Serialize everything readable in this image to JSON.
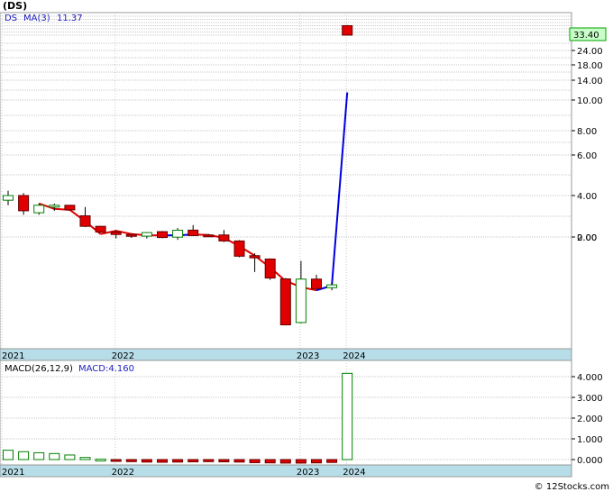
{
  "ticker": "(DS)",
  "legend": {
    "symbol": "DS",
    "ma_label": "MA(3)",
    "ma_value": "11.37"
  },
  "macd_legend": {
    "label": "MACD(26,12,9)",
    "value_label": "MACD:4.160"
  },
  "last_price_label": "33.40",
  "watermark": "© 12Stocks.com",
  "colors": {
    "up_candle": "#008000",
    "down_candle": "#e00000",
    "ma_down": "#e00000",
    "ma_up": "#0000e0",
    "axis_strip": "#b7dde8",
    "price_box": "#c8ffc8"
  },
  "chart_data": [
    {
      "type": "candlestick",
      "y_scale": "log",
      "y_tick_labels": [
        "33.40",
        "24.00",
        "18.00",
        "14.00",
        "10.00",
        "8.00",
        "6.00",
        "4.00",
        "2.00",
        "0.00"
      ],
      "y_tick_values": [
        33.4,
        24,
        18,
        14,
        10,
        8,
        6,
        4,
        2,
        1
      ],
      "x_labels": [
        "2021",
        "2022",
        "2023",
        "2024"
      ],
      "candles": [
        {
          "o": 3.7,
          "h": 4.2,
          "l": 3.4,
          "c": 4.0
        },
        {
          "o": 4.0,
          "h": 4.1,
          "l": 2.9,
          "c": 3.1
        },
        {
          "o": 3.0,
          "h": 3.5,
          "l": 2.9,
          "c": 3.4
        },
        {
          "o": 3.3,
          "h": 3.5,
          "l": 3.1,
          "c": 3.4
        },
        {
          "o": 3.4,
          "h": 3.4,
          "l": 3.1,
          "c": 3.15
        },
        {
          "o": 2.85,
          "h": 3.3,
          "l": 1.75,
          "c": 1.82
        },
        {
          "o": 1.82,
          "h": 1.85,
          "l": 1.28,
          "c": 1.32
        },
        {
          "o": 1.32,
          "h": 1.45,
          "l": 0.92,
          "c": 1.15
        },
        {
          "o": 1.15,
          "h": 1.2,
          "l": 0.95,
          "c": 1.08
        },
        {
          "o": 1.05,
          "h": 1.32,
          "l": 0.92,
          "c": 1.28
        },
        {
          "o": 1.35,
          "h": 1.4,
          "l": 0.93,
          "c": 0.97
        },
        {
          "o": 0.99,
          "h": 1.65,
          "l": 0.85,
          "c": 1.46
        },
        {
          "o": 1.47,
          "h": 1.95,
          "l": 1.05,
          "c": 1.08
        },
        {
          "o": 1.12,
          "h": 1.18,
          "l": 1.03,
          "c": 1.08
        },
        {
          "o": 1.12,
          "h": 1.48,
          "l": 0.75,
          "c": 0.8
        },
        {
          "o": 0.8,
          "h": 0.84,
          "l": 0.32,
          "c": 0.34
        },
        {
          "o": 0.35,
          "h": 0.4,
          "l": 0.14,
          "c": 0.31
        },
        {
          "o": 0.29,
          "h": 0.3,
          "l": 0.09,
          "c": 0.1
        },
        {
          "o": 0.095,
          "h": 0.1,
          "l": 0.007,
          "c": 0.0072
        },
        {
          "o": 0.0082,
          "h": 0.26,
          "l": 0.0078,
          "c": 0.094
        },
        {
          "o": 0.094,
          "h": 0.12,
          "l": 0.052,
          "c": 0.055
        },
        {
          "o": 0.058,
          "h": 0.075,
          "l": 0.05,
          "c": 0.068
        },
        {
          "o": 41.0,
          "h": 41.5,
          "l": 33.4,
          "c": 33.4
        }
      ],
      "ma3": [
        null,
        null,
        3.5,
        3.2,
        3.15,
        2.6,
        2.1,
        1.42,
        1.18,
        1.1,
        1.09,
        1.1,
        1.15,
        1.12,
        0.95,
        0.6,
        0.35,
        0.18,
        0.085,
        0.06,
        0.05,
        0.065,
        11.37
      ]
    },
    {
      "type": "bar",
      "title": "MACD(26,12,9)",
      "y_tick_labels": [
        "4.000",
        "3.000",
        "2.000",
        "1.000",
        "0.000"
      ],
      "y_tick_values": [
        4,
        3,
        2,
        1,
        0
      ],
      "ylim": [
        -0.2,
        4.3
      ],
      "x_labels": [
        "2021",
        "2022",
        "2023",
        "2024"
      ],
      "values": [
        0.45,
        0.38,
        0.33,
        0.29,
        0.22,
        0.1,
        0.02,
        -0.04,
        -0.1,
        -0.12,
        -0.13,
        -0.12,
        -0.11,
        -0.1,
        -0.11,
        -0.12,
        -0.15,
        -0.16,
        -0.17,
        -0.17,
        -0.16,
        -0.14,
        4.16
      ]
    }
  ]
}
